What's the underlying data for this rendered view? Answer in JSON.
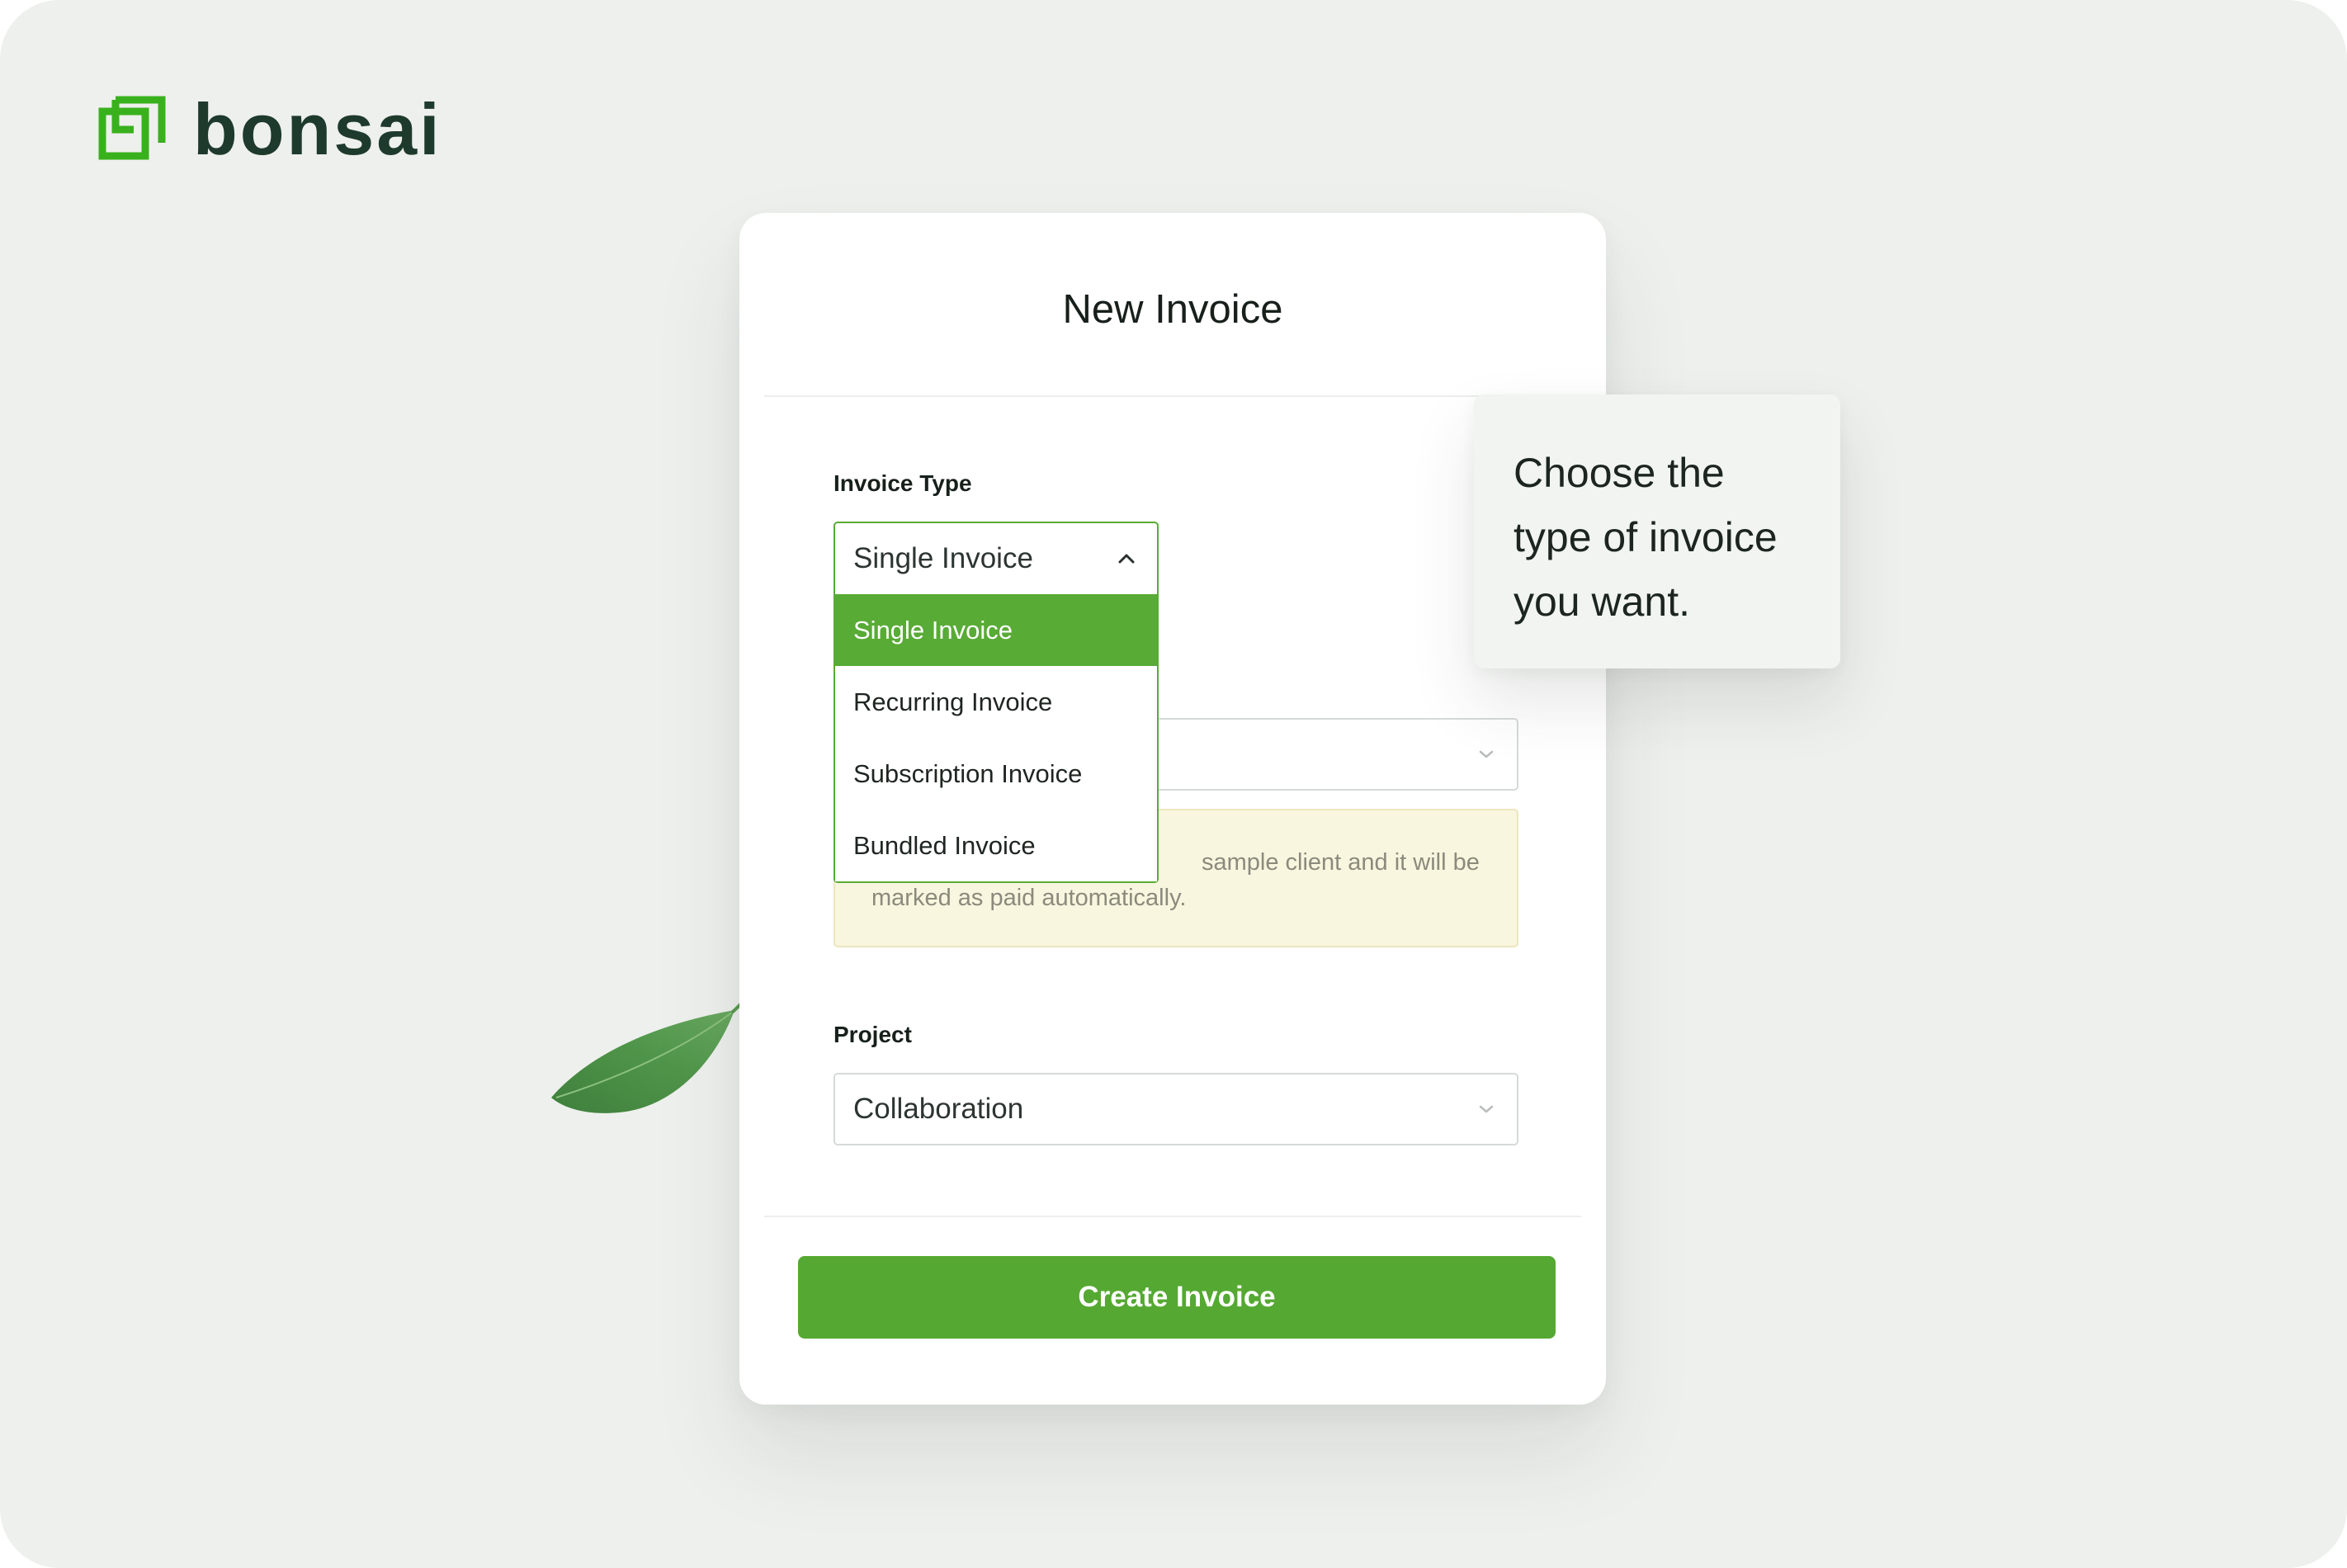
{
  "brand": {
    "name": "bonsai",
    "logo_icon": "bonsai-logo-icon",
    "accent_color": "#55a932"
  },
  "modal": {
    "title": "New Invoice",
    "invoice_type": {
      "label": "Invoice Type",
      "selected": "Single Invoice",
      "expanded": true,
      "options": [
        {
          "label": "Single Invoice",
          "highlighted": true
        },
        {
          "label": "Recurring Invoice",
          "highlighted": false
        },
        {
          "label": "Subscription Invoice",
          "highlighted": false
        },
        {
          "label": "Bundled Invoice",
          "highlighted": false
        }
      ]
    },
    "notice": {
      "line1": "sample client and it will be",
      "line2": "marked as paid automatically."
    },
    "project": {
      "label": "Project",
      "selected": "Collaboration"
    },
    "create_button": "Create Invoice"
  },
  "tooltip": {
    "text": "Choose the type of invoice you want."
  },
  "decorations": {
    "leaf": "leaf-illustration"
  }
}
